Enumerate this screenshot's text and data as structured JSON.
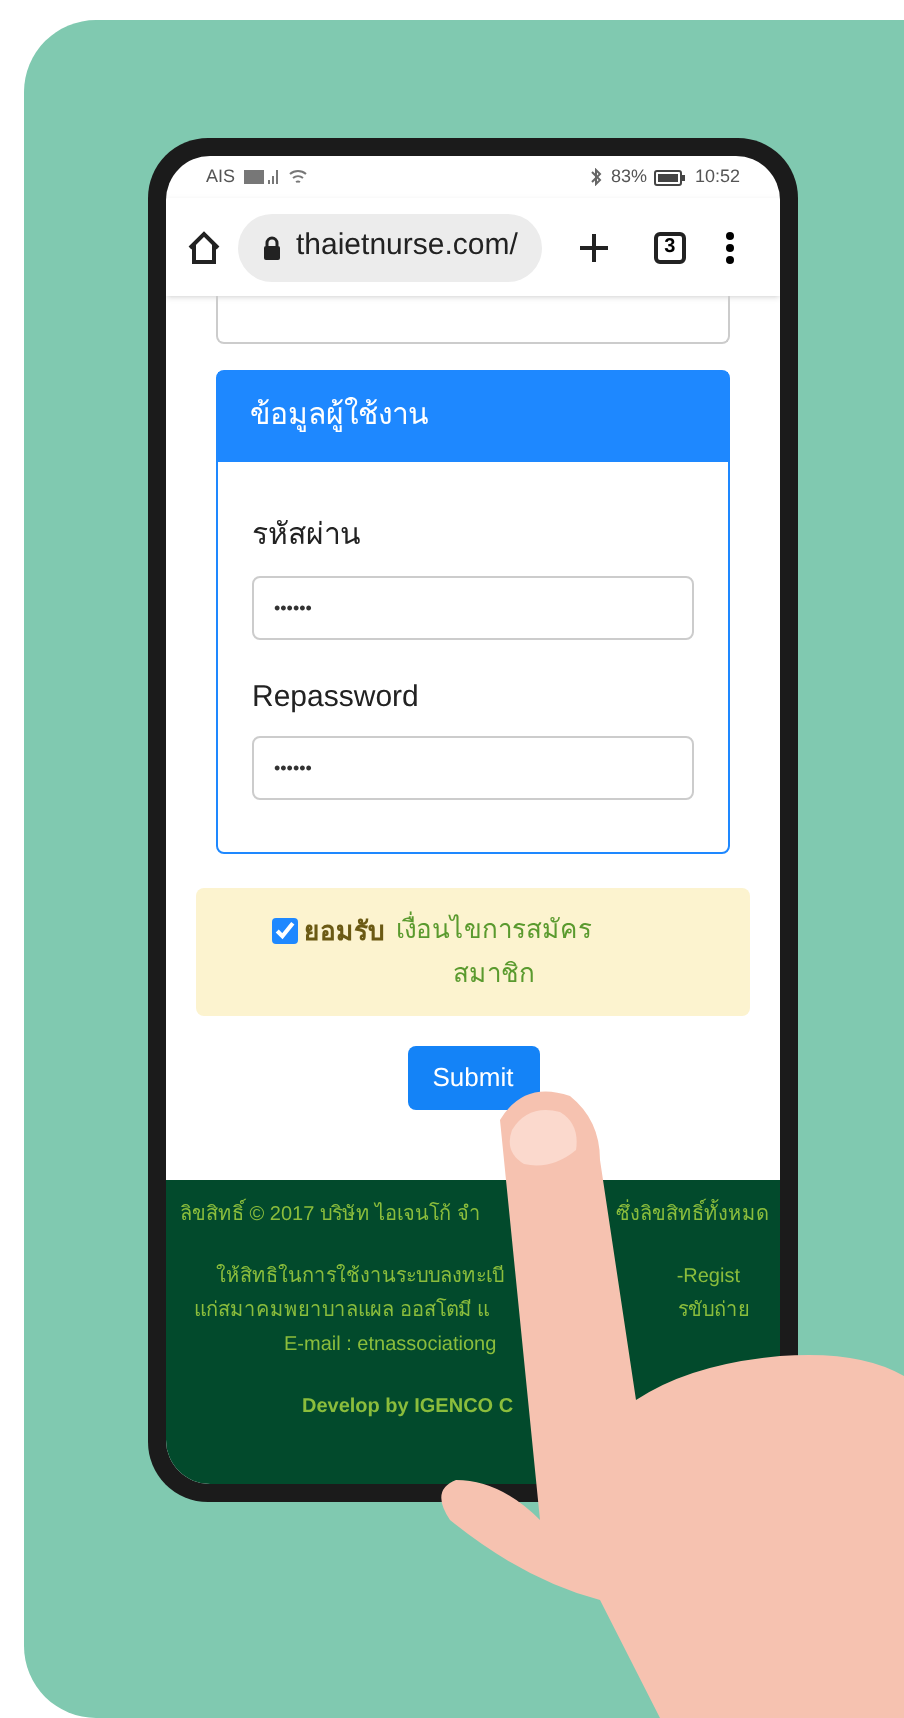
{
  "status_bar": {
    "carrier": "AIS",
    "battery": "83%",
    "time": "10:52"
  },
  "browser": {
    "url": "thaietnurse.com/",
    "tab_count": "3"
  },
  "card": {
    "title": "ข้อมูลผู้ใช้งาน",
    "fields": [
      {
        "label": "รหัสผ่าน",
        "value": "••••••"
      },
      {
        "label": "Repassword",
        "value": "••••••"
      }
    ]
  },
  "agreement": {
    "checked": true,
    "label": "ยอมรับ",
    "link": "เงื่อนไขการสมัครสมาชิก"
  },
  "submit": "Submit",
  "footer": {
    "lines": [
      {
        "left": "ลิขสิทธิ์ © 2017 บริษัท ไอเจนโก้ จำ",
        "right": "ซึ่งลิขสิทธิ์ทั้งหมด"
      },
      {
        "left": "ให้สิทธิในการใช้งานระบบลงทะเบี",
        "right": "-Regist"
      },
      {
        "left": "แก่สมาคมพยาบาลแผล ออสโตมี แ",
        "right": "รขับถ่าย"
      },
      {
        "left": "E-mail : etnassociationg"
      },
      {
        "left": "Develop by IGENCO C"
      }
    ]
  }
}
